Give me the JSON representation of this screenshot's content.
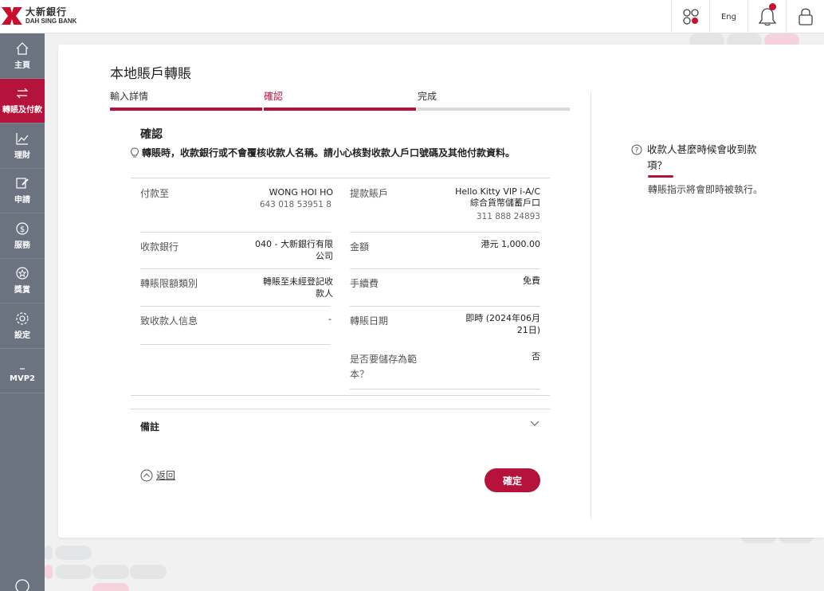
{
  "brand": {
    "name_zh": "大新銀行",
    "name_en": "DAH SING BANK",
    "accent": "#b5123c",
    "sidebar_bg": "#6c7380"
  },
  "topbar": {
    "lang_label": "Eng",
    "icons": [
      "apps-icon",
      "bell-icon",
      "lock-icon"
    ]
  },
  "sidebar": {
    "items": [
      {
        "label": "主頁",
        "icon": "home-icon",
        "active": false
      },
      {
        "label": "轉賬及付款",
        "icon": "transfer-icon",
        "active": true
      },
      {
        "label": "理財",
        "icon": "chart-icon",
        "active": false
      },
      {
        "label": "申請",
        "icon": "edit-icon",
        "active": false
      },
      {
        "label": "服務",
        "icon": "dollar-icon",
        "active": false
      },
      {
        "label": "獎賞",
        "icon": "reward-icon",
        "active": false
      },
      {
        "label": "設定",
        "icon": "gear-icon",
        "active": false
      },
      {
        "label": "MVP2",
        "icon": "dash-icon",
        "active": false
      }
    ]
  },
  "page": {
    "title": "本地賬戶轉賬",
    "steps": [
      {
        "label": "輸入詳情",
        "state": "done"
      },
      {
        "label": "確認",
        "state": "current"
      },
      {
        "label": "完成",
        "state": "pending"
      }
    ],
    "confirm_title": "確認",
    "notice": "轉賬時，收款銀行或不會覆核收款人名稱。請小心核對收款人戶口號碼及其他付款資料。"
  },
  "details": {
    "payee_label": "付款至",
    "payee_name": "WONG HOI HO",
    "payee_account": "643 018 53951 8",
    "from_label": "提款賬戶",
    "from_name_1": "Hello Kitty VIP i-A/C",
    "from_name_2": "綜合貨幣儲蓄戶口",
    "from_account": "311 888 24893",
    "bank_label": "收款銀行",
    "bank_value_1": "040 - 大新銀行有限",
    "bank_value_2": "公司",
    "amount_label": "金額",
    "amount_value": "港元 1,000.00",
    "limit_label": "轉賬限額類別",
    "limit_value_1": "轉賬至未經登記收",
    "limit_value_2": "款人",
    "fee_label": "手續費",
    "fee_value": "免費",
    "message_label": "致收款人信息",
    "message_value": "-",
    "date_label": "轉賬日期",
    "date_value_1": "即時 (2024年06月",
    "date_value_2": "21日)",
    "template_label_1": "是否要儲存為範",
    "template_label_2": "本？",
    "template_value": "否"
  },
  "remarks": {
    "label": "備註"
  },
  "actions": {
    "back_label": "返回",
    "confirm_label": "確定"
  },
  "faq": {
    "question_1": "收款人甚麼時候會收到款",
    "question_2": "項？",
    "answer": "轉賬指示將會即時被執行。"
  }
}
